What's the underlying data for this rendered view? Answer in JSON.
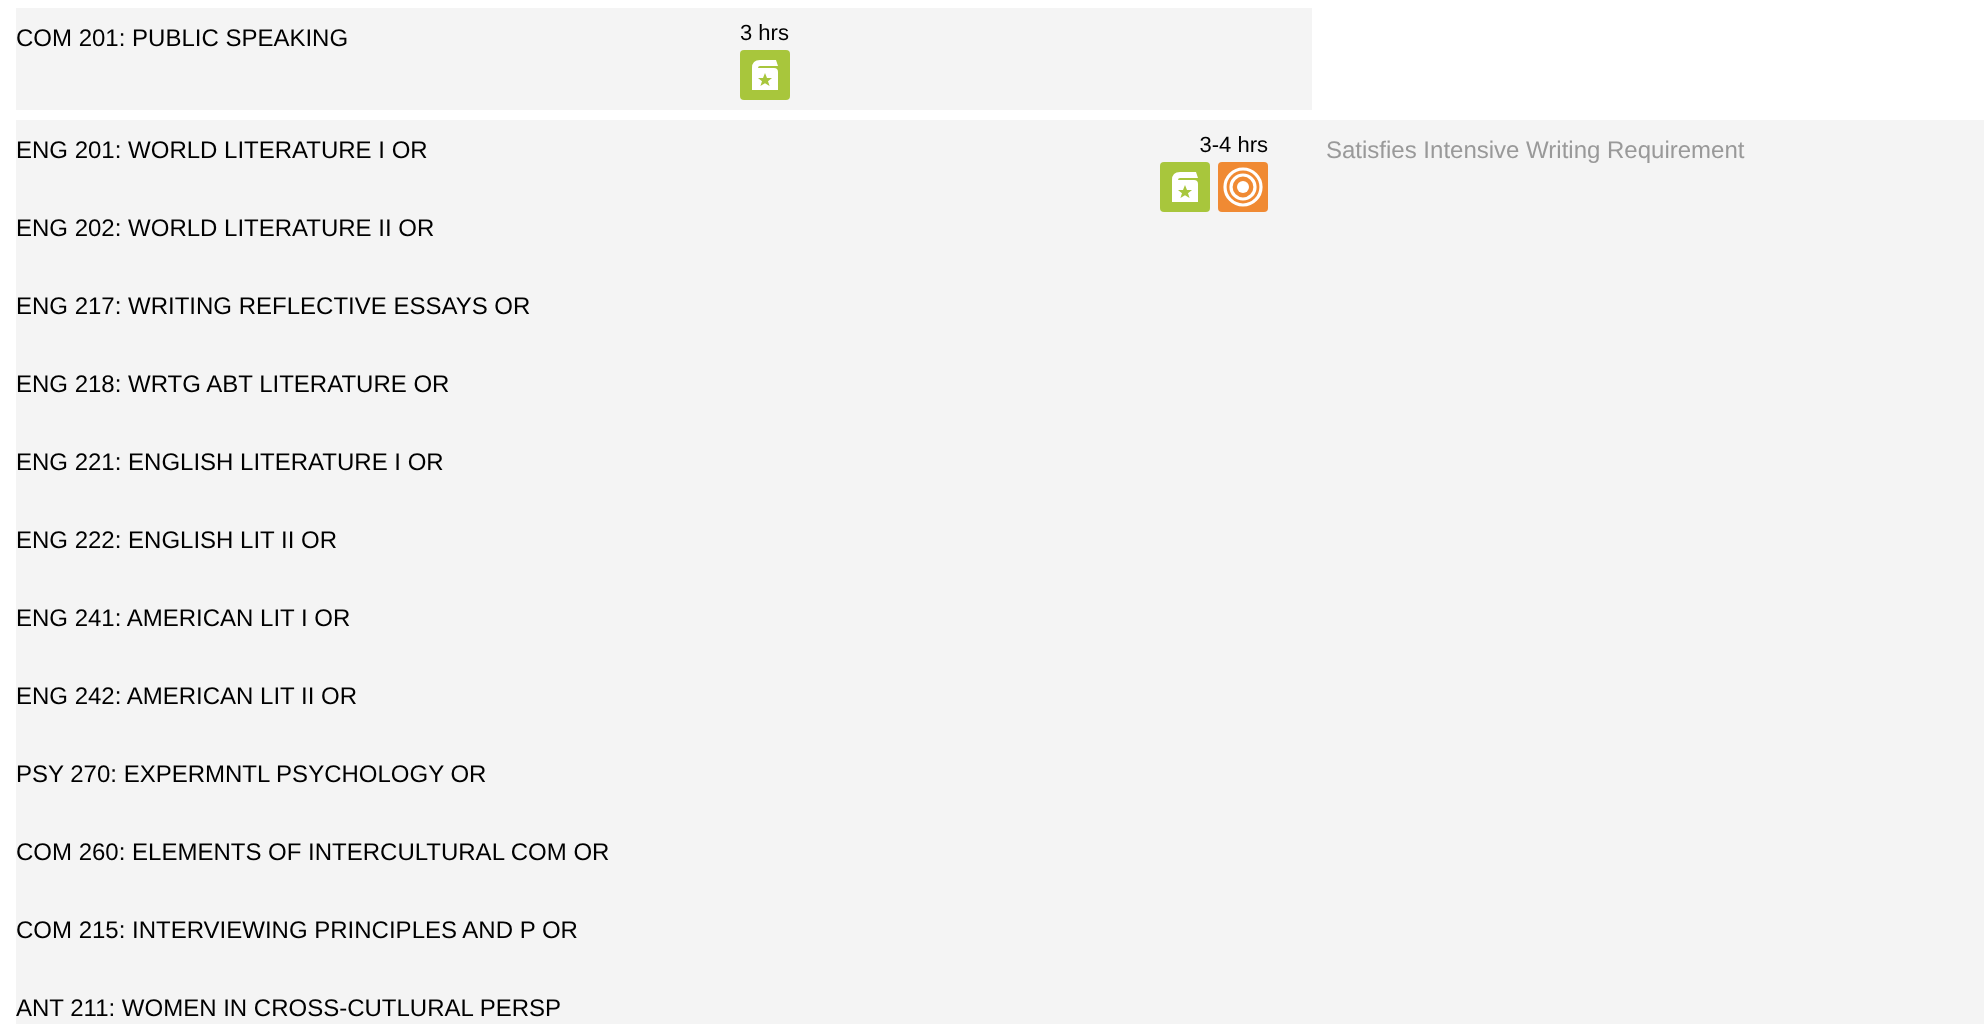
{
  "sections": [
    {
      "courses": [
        "COM 201: PUBLIC SPEAKING"
      ],
      "hours": "3 hrs",
      "badges": [
        {
          "kind": "assignment"
        }
      ]
    },
    {
      "courses": [
        "ENG 201: WORLD LITERATURE I OR",
        "ENG 202: WORLD LITERATURE II OR",
        "ENG 217: WRITING REFLECTIVE ESSAYS OR",
        "ENG 218: WRTG ABT LITERATURE OR",
        "ENG 221: ENGLISH LITERATURE I OR",
        "ENG 222: ENGLISH LIT II OR",
        "ENG 241: AMERICAN LIT I OR",
        "ENG 242: AMERICAN LIT II OR",
        "PSY 270: EXPERMNTL PSYCHOLOGY OR",
        "COM 260: ELEMENTS OF INTERCULTURAL COM OR",
        "COM 215: INTERVIEWING PRINCIPLES AND P OR",
        "ANT 211: WOMEN IN CROSS-CUTLURAL PERSP"
      ],
      "hours": "3-4 hrs",
      "badges": [
        {
          "kind": "assignment"
        },
        {
          "kind": "rings"
        }
      ],
      "note": "Satisfies Intensive Writing Requirement"
    }
  ]
}
